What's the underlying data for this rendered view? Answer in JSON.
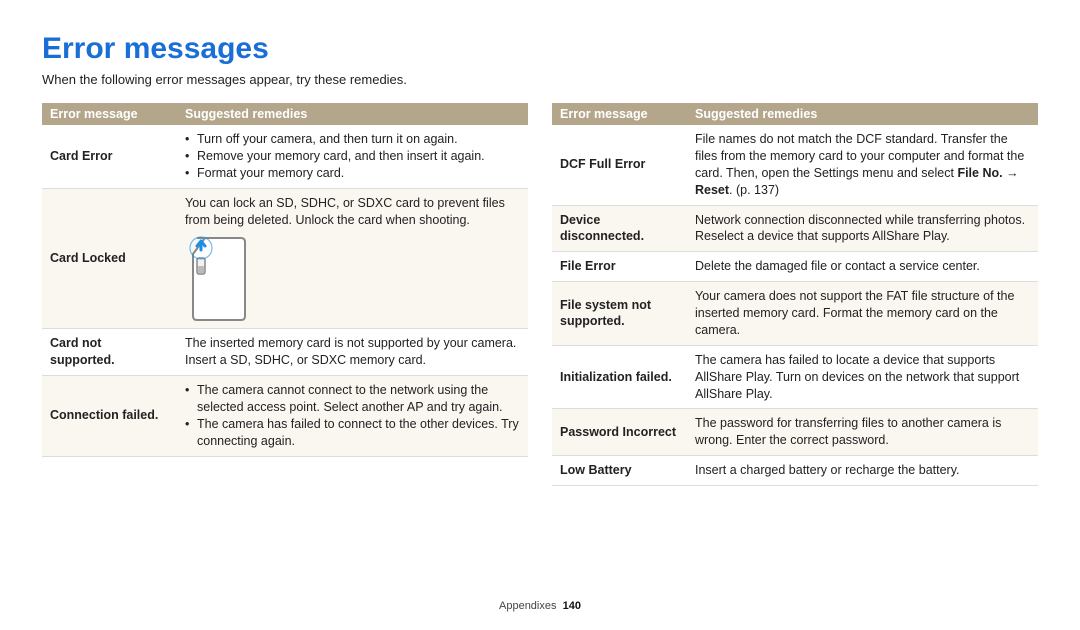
{
  "title": "Error messages",
  "intro": "When the following error messages appear, try these remedies.",
  "headers": {
    "col1": "Error message",
    "col2": "Suggested remedies"
  },
  "left": [
    {
      "name": "Card Error",
      "remedy_list": [
        "Turn off your camera, and then turn it on again.",
        "Remove your memory card, and then insert it again.",
        "Format your memory card."
      ]
    },
    {
      "name": "Card Locked",
      "remedy": "You can lock an SD, SDHC, or SDXC card to prevent files from being deleted. Unlock the card when shooting.",
      "has_icon": true
    },
    {
      "name": "Card not supported.",
      "remedy": "The inserted memory card is not supported by your camera. Insert a SD, SDHC, or SDXC memory card."
    },
    {
      "name": "Connection failed.",
      "remedy_list": [
        "The camera cannot connect to the network using the selected access point. Select another AP and try again.",
        "The camera has failed to connect to the other devices. Try connecting again."
      ]
    }
  ],
  "right": [
    {
      "name": "DCF Full Error",
      "remedy_html": "File names do not match the DCF standard. Transfer the files from the memory card to your computer and format the card. Then, open the Settings menu and select <b>File No.</b> → <b>Reset</b>. (p. 137)"
    },
    {
      "name": "Device disconnected.",
      "remedy": "Network connection disconnected while transferring photos. Reselect a device that supports AllShare Play."
    },
    {
      "name": "File Error",
      "remedy": "Delete the damaged file or contact a service center."
    },
    {
      "name": "File system not supported.",
      "remedy": "Your camera does not support the FAT file structure of the inserted memory card. Format the memory card on the camera."
    },
    {
      "name": "Initialization failed.",
      "remedy": "The camera has failed to locate a device that supports AllShare Play. Turn on devices on the network that support AllShare Play."
    },
    {
      "name": "Password Incorrect",
      "remedy": "The password for transferring files to another camera is wrong. Enter the correct password."
    },
    {
      "name": "Low Battery",
      "remedy": "Insert a charged battery or recharge the battery."
    }
  ],
  "footer": {
    "section": "Appendixes",
    "page": "140"
  }
}
